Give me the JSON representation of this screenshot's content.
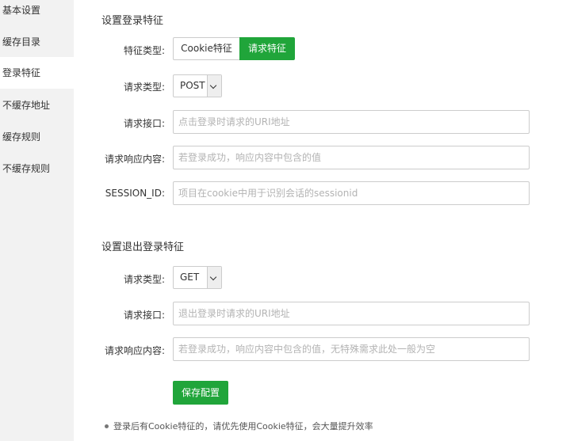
{
  "sidebar": {
    "items": [
      {
        "label": "基本设置"
      },
      {
        "label": "缓存目录"
      },
      {
        "label": "登录特征"
      },
      {
        "label": "不缓存地址"
      },
      {
        "label": "缓存规则"
      },
      {
        "label": "不缓存规则"
      }
    ]
  },
  "login": {
    "title": "设置登录特征",
    "feature_type_label": "特征类型:",
    "feature_options": [
      "Cookie特征",
      "请求特征"
    ],
    "selected_feature": "请求特征",
    "request_type_label": "请求类型:",
    "request_type_value": "POST",
    "api_label": "请求接口:",
    "api_placeholder": "点击登录时请求的URI地址",
    "response_label": "请求响应内容:",
    "response_placeholder": "若登录成功，响应内容中包含的值",
    "session_label": "SESSION_ID:",
    "session_placeholder": "项目在cookie中用于识别会话的sessionid"
  },
  "logout": {
    "title": "设置退出登录特征",
    "request_type_label": "请求类型:",
    "request_type_value": "GET",
    "api_label": "请求接口:",
    "api_placeholder": "退出登录时请求的URI地址",
    "response_label": "请求响应内容:",
    "response_placeholder": "若登录成功，响应内容中包含的值，无特殊需求此处一般为空"
  },
  "save_label": "保存配置",
  "tip": "登录后有Cookie特征的，请优先使用Cookie特征，会大量提升效率",
  "colors": {
    "accent": "#20a53a",
    "sidebar_bg": "#f2f2f2"
  }
}
